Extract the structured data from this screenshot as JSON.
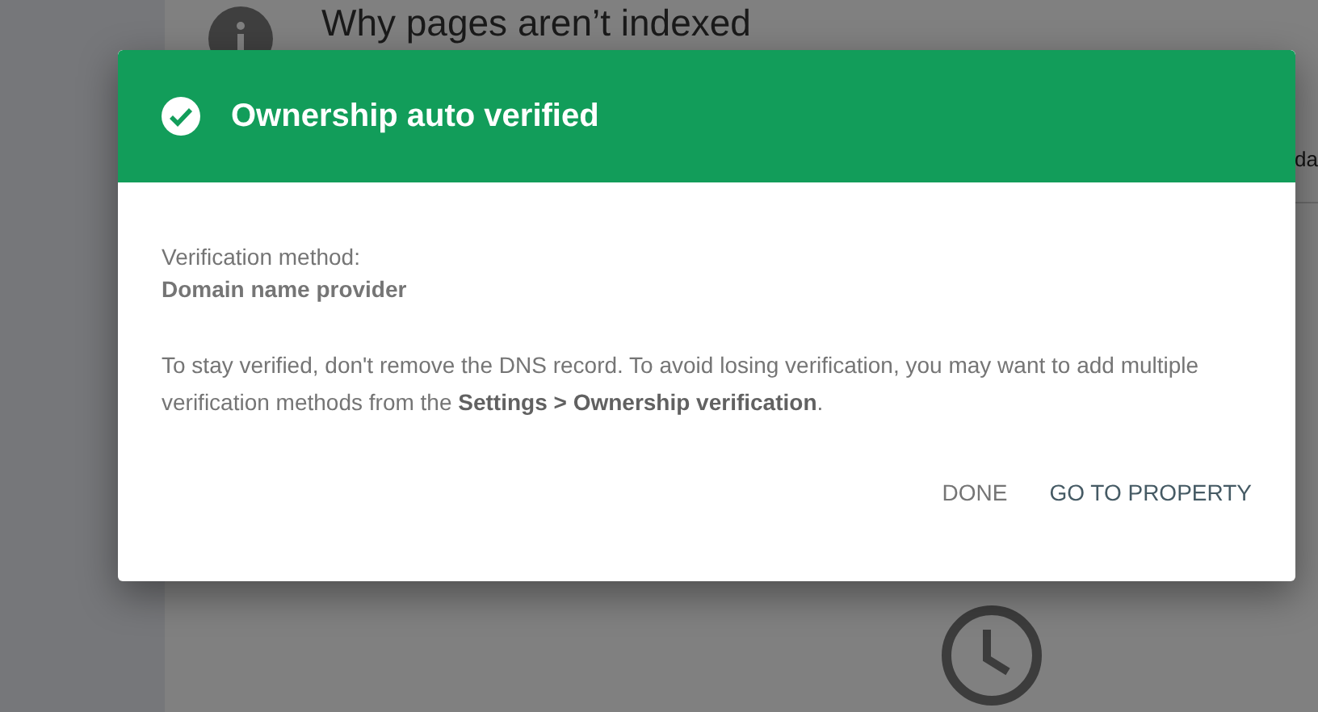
{
  "page": {
    "heading": "Why pages aren’t indexed",
    "side_text": "da"
  },
  "dialog": {
    "title": "Ownership auto verified",
    "verified": true,
    "method_label": "Verification method:",
    "method_value": "Domain name provider",
    "message": "To stay verified, don't remove the DNS record. To avoid losing verification, you may want to add multiple verification methods from the **Settings > Ownership verification**.",
    "buttons": [
      {
        "label": "DONE",
        "kind": "secondary"
      },
      {
        "label": "GO TO PROPERTY",
        "kind": "primary"
      }
    ]
  }
}
